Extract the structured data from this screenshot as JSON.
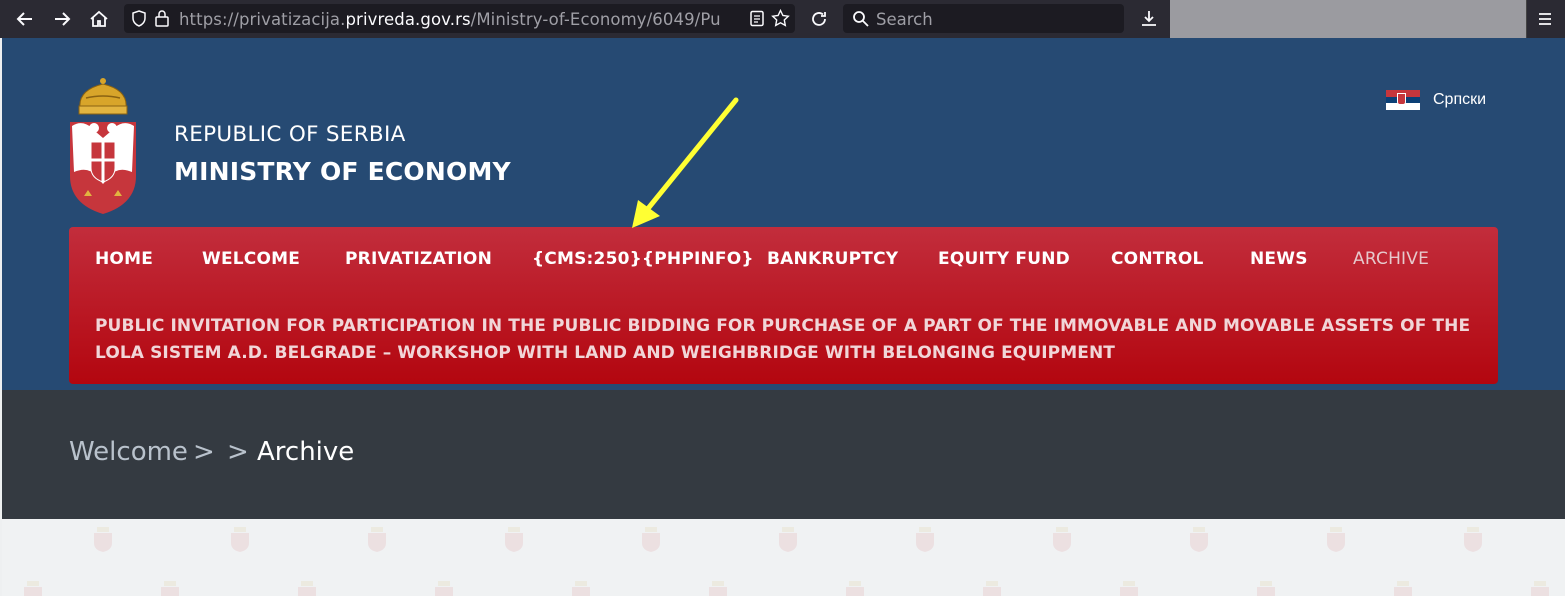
{
  "browser": {
    "url_prefix": "https://privatizacija.",
    "url_domain": "privreda.gov.rs",
    "url_rest": "/Ministry-of-Economy/6049/Pu",
    "search_placeholder": "Search"
  },
  "header": {
    "line1": "REPUBLIC OF SERBIA",
    "line2": "MINISTRY OF ECONOMY",
    "language": "Српски"
  },
  "menu": {
    "items": [
      "HOME",
      "WELCOME",
      "PRIVATIZATION",
      "{CMS:250}{PHPINFO}",
      "BANKRUPTCY",
      "EQUITY FUND",
      "CONTROL",
      "NEWS",
      "ARCHIVE"
    ],
    "submenu_item": "PUBLIC INVITATION FOR PARTICIPATION IN THE PUBLIC BIDDING FOR PURCHASE OF A PART OF THE IMMOVABLE AND MOVABLE ASSETS OF THE LOLA SISTEM A.D. BELGRADE – WORKSHOP WITH LAND AND WEIGHBRIDGE WITH BELONGING EQUIPMENT"
  },
  "breadcrumb": {
    "first": "Welcome",
    "sep1": ">",
    "sep2": ">",
    "current": "Archive"
  },
  "colors": {
    "header_bg": "#264a73",
    "menu_red": "#c22d3c",
    "breadcrumb_bg": "#343a41",
    "annotation_arrow": "#ffff33"
  },
  "icons": [
    "back-arrow-icon",
    "forward-arrow-icon",
    "home-icon",
    "shield-icon",
    "lock-icon",
    "reader-view-icon",
    "bookmark-star-icon",
    "reload-icon",
    "search-icon",
    "downloads-icon",
    "app-menu-icon",
    "coat-of-arms-icon",
    "serbian-flag-icon",
    "annotation-arrow-icon"
  ]
}
